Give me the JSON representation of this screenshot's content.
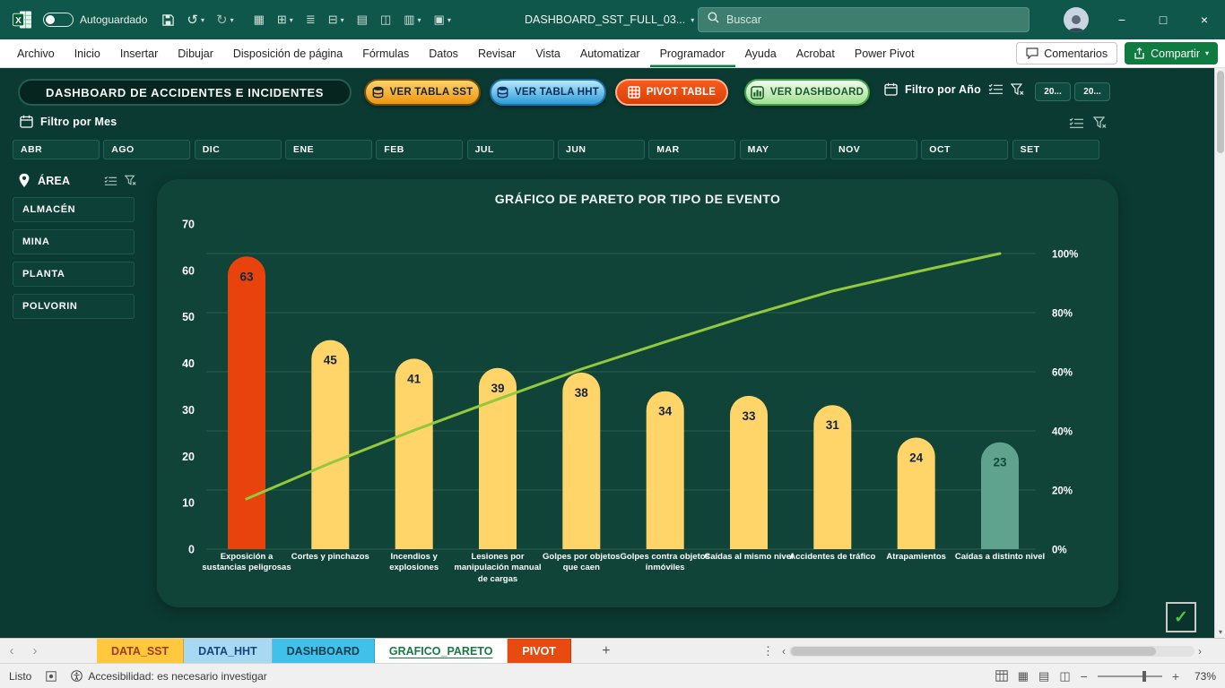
{
  "titlebar": {
    "autosave_label": "Autoguardado",
    "doc_title": "DASHBOARD_SST_FULL_03...",
    "search_placeholder": "Buscar"
  },
  "menubar": {
    "tabs": [
      "Archivo",
      "Inicio",
      "Insertar",
      "Dibujar",
      "Disposición de página",
      "Fórmulas",
      "Datos",
      "Revisar",
      "Vista",
      "Automatizar",
      "Programador",
      "Ayuda",
      "Acrobat",
      "Power Pivot"
    ],
    "active_tab": "Programador",
    "comments_label": "Comentarios",
    "share_label": "Compartir"
  },
  "dashboard": {
    "title": "DASHBOARD DE ACCIDENTES E INCIDENTES",
    "action_buttons": [
      {
        "id": "ver-tabla-sst",
        "label": "VER TABLA SST",
        "icon": "database",
        "bg1": "#FFD368",
        "bg2": "#EE9410",
        "border": "#6B4E12",
        "text": "#14233F"
      },
      {
        "id": "ver-tabla-hht",
        "label": "VER TABLA HHT",
        "icon": "database",
        "bg1": "#B8E8FC",
        "bg2": "#2D9CD9",
        "border": "#1F6FA8",
        "text": "#0B2E5C"
      },
      {
        "id": "pivot-table",
        "label": "PIVOT TABLE",
        "icon": "grid",
        "bg1": "#F95A1E",
        "bg2": "#D84103",
        "border": "#FFB08F",
        "text": "#FFFFFF"
      },
      {
        "id": "ver-dashboard",
        "label": "VER DASHBOARD",
        "icon": "chart",
        "bg1": "#F2FBEC",
        "bg2": "#9FDF90",
        "border": "#3FA24E",
        "text": "#1C5A2E"
      }
    ],
    "year_filter": {
      "label": "Filtro por Año",
      "years": [
        "20...",
        "20..."
      ]
    },
    "month_filter": {
      "label": "Filtro por Mes",
      "months": [
        "ABR",
        "AGO",
        "DIC",
        "ENE",
        "FEB",
        "JUL",
        "JUN",
        "MAR",
        "MAY",
        "NOV",
        "OCT",
        "SET"
      ]
    },
    "area_filter": {
      "label": "ÁREA",
      "items": [
        "ALMACÉN",
        "MINA",
        "PLANTA",
        "POLVORIN"
      ]
    }
  },
  "chart_data": {
    "type": "pareto (bar+line)",
    "title": "GRÁFICO DE PARETO POR TIPO DE EVENTO",
    "categories": [
      "Exposición a sustancias peligrosas",
      "Cortes y pinchazos",
      "Incendios y explosiones",
      "Lesiones por manipulación manual de cargas",
      "Golpes por objetos que caen",
      "Golpes contra objetos inmóviles",
      "Caídas al mismo nivel",
      "Accidentes de tráfico",
      "Atrapamientos",
      "Caídas a distinto nivel"
    ],
    "values": [
      63,
      45,
      41,
      39,
      38,
      34,
      33,
      31,
      24,
      23
    ],
    "cumulative_pct": [
      17.0,
      29.1,
      40.2,
      50.7,
      60.9,
      70.1,
      79.0,
      87.3,
      93.8,
      100.0
    ],
    "bar_colors": [
      "#E8430D",
      "#FFD469",
      "#FFD469",
      "#FFD469",
      "#FFD469",
      "#FFD469",
      "#FFD469",
      "#FFD469",
      "#FFD469",
      "#5FA38F"
    ],
    "value_label_colors": [
      "#16243E",
      "#16243E",
      "#16243E",
      "#16243E",
      "#16243E",
      "#16243E",
      "#16243E",
      "#16243E",
      "#16243E",
      "#0F4A3C"
    ],
    "line_color": "#94C83D",
    "left_axis": {
      "ticks": [
        0,
        10,
        20,
        30,
        40,
        50,
        60,
        70
      ],
      "max": 70
    },
    "right_axis": {
      "ticks": [
        "0%",
        "20%",
        "40%",
        "60%",
        "80%",
        "100%"
      ],
      "max_pct": 100
    },
    "grid": true,
    "legend": "none"
  },
  "sheet_bar": {
    "tabs": [
      {
        "label": "DATA_SST",
        "bg": "#FFC83D",
        "color": "#A33B20",
        "active": false
      },
      {
        "label": "DATA_HHT",
        "bg": "#A7D9F2",
        "color": "#14477D",
        "active": false
      },
      {
        "label": "DASHBOARD",
        "bg": "#3FC1EA",
        "color": "#0B3D4C",
        "active": false
      },
      {
        "label": "GRAFICO_PARETO",
        "bg": "#FFFFFF",
        "color": "#187A45",
        "active": true
      },
      {
        "label": "PIVOT",
        "bg": "#E94A0F",
        "color": "#FFFFFF",
        "active": false
      }
    ],
    "add_label": "+"
  },
  "status_bar": {
    "ready_label": "Listo",
    "accessibility_text": "Accesibilidad: es necesario investigar",
    "zoom_percent": "73%"
  },
  "icons": {
    "caret": "▾",
    "undo": "↺",
    "redo": "↻",
    "minimize": "−",
    "maximize": "□",
    "close": "×",
    "nav_left": "‹",
    "nav_right": "›",
    "dots": "⋮",
    "plus": "+",
    "check": "✓",
    "zoom_out": "−",
    "zoom_in": "+",
    "view_icons": [
      "▦",
      "▤",
      "◫"
    ],
    "qat": [
      "▦",
      "⊞",
      "≣",
      "⊟",
      "▤",
      "◫",
      "▥",
      "▣"
    ]
  },
  "colors": {
    "titlebar_bg": "#0E574A",
    "canvas_bg": "#0B3A32",
    "panel_bg": "#104439",
    "excel_green": "#0F7B41",
    "pareto_line": "#94C83D"
  }
}
